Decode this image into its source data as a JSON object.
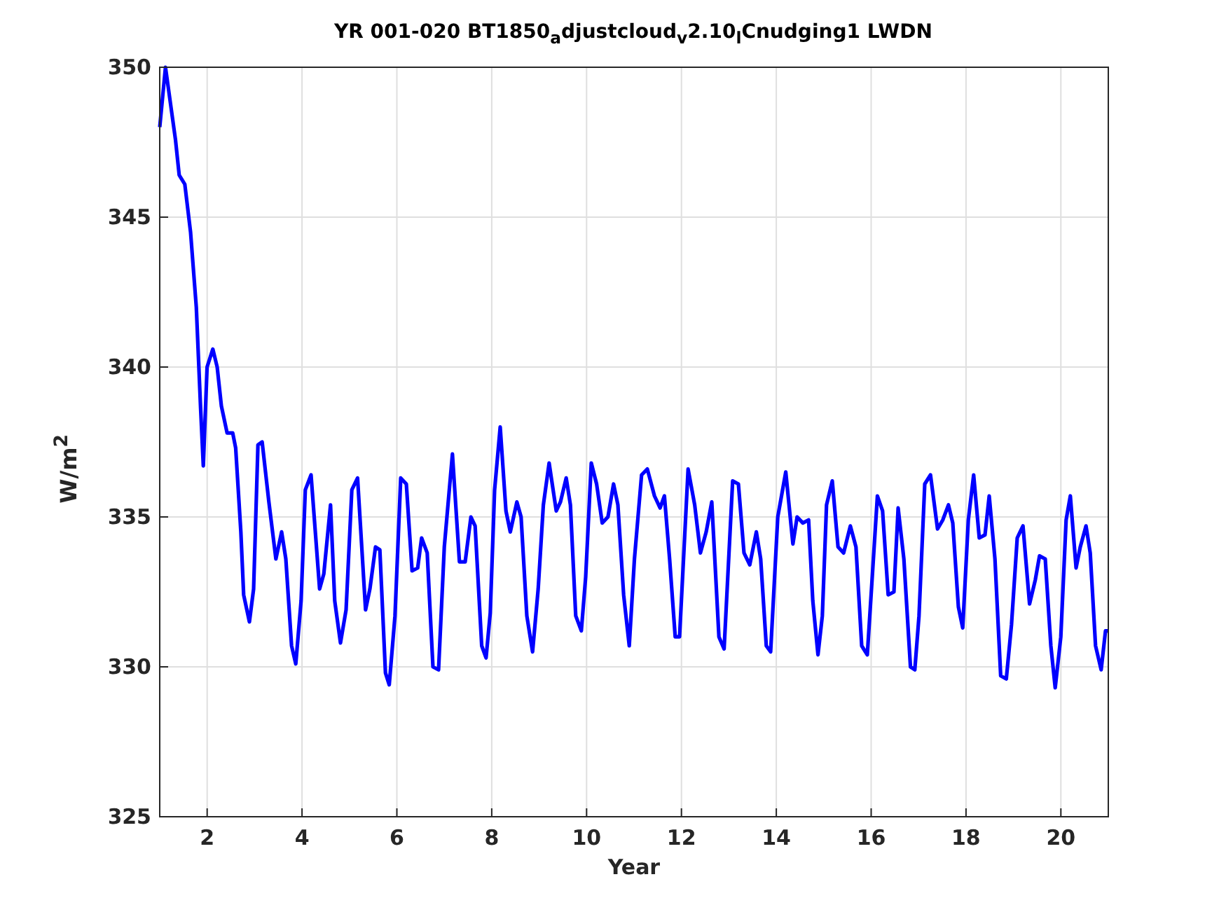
{
  "figure": {
    "chart_data": {
      "type": "line",
      "title": "YR 001-020 BT1850$_{a}$djustcloud$_{v}$2.10$_{l}$Cnudging1 LWDN",
      "xlabel": "Year",
      "ylabel": "W/m$^{2}$",
      "grid": true,
      "xlim": [
        1,
        21
      ],
      "ylim": [
        325,
        350
      ],
      "xticks": [
        2,
        4,
        6,
        8,
        10,
        12,
        14,
        16,
        18,
        20
      ],
      "yticks": [
        325,
        330,
        335,
        340,
        345,
        350
      ],
      "x": [
        1,
        1.12,
        1.33,
        1.41,
        1.53,
        1.65,
        1.77,
        1.86,
        1.92,
        2.0,
        2.12,
        2.21,
        2.3,
        2.42,
        2.54,
        2.6,
        2.71,
        2.77,
        2.89,
        2.98,
        3.07,
        3.16,
        3.3,
        3.45,
        3.57,
        3.66,
        3.78,
        3.87,
        3.98,
        4.07,
        4.19,
        4.37,
        4.46,
        4.6,
        4.69,
        4.81,
        4.93,
        5.05,
        5.17,
        5.34,
        5.43,
        5.55,
        5.64,
        5.76,
        5.84,
        5.96,
        6.08,
        6.2,
        6.32,
        6.44,
        6.52,
        6.64,
        6.76,
        6.88,
        7.0,
        7.17,
        7.32,
        7.44,
        7.56,
        7.65,
        7.79,
        7.88,
        7.97,
        8.06,
        8.18,
        8.3,
        8.39,
        8.53,
        8.62,
        8.74,
        8.86,
        8.98,
        9.09,
        9.21,
        9.36,
        9.45,
        9.57,
        9.66,
        9.77,
        9.89,
        9.98,
        10.1,
        10.21,
        10.33,
        10.45,
        10.57,
        10.66,
        10.78,
        10.9,
        11.01,
        11.16,
        11.28,
        11.43,
        11.55,
        11.64,
        11.75,
        11.87,
        11.96,
        12.14,
        12.28,
        12.4,
        12.52,
        12.64,
        12.79,
        12.9,
        13.08,
        13.2,
        13.32,
        13.44,
        13.58,
        13.67,
        13.79,
        13.88,
        14.03,
        14.2,
        14.35,
        14.44,
        14.56,
        14.68,
        14.77,
        14.88,
        14.97,
        15.06,
        15.18,
        15.3,
        15.42,
        15.56,
        15.68,
        15.8,
        15.92,
        16.13,
        16.24,
        16.36,
        16.48,
        16.57,
        16.69,
        16.83,
        16.92,
        17.01,
        17.13,
        17.25,
        17.4,
        17.51,
        17.63,
        17.72,
        17.84,
        17.93,
        18.05,
        18.16,
        18.28,
        18.4,
        18.49,
        18.61,
        18.73,
        18.85,
        18.96,
        19.08,
        19.2,
        19.34,
        19.46,
        19.55,
        19.67,
        19.79,
        19.88,
        20.0,
        20.11,
        20.2,
        20.32,
        20.41,
        20.53,
        20.62,
        20.73,
        20.85,
        20.94,
        21
      ],
      "series": [
        {
          "color": "#0000ff",
          "values": [
            348,
            350,
            347.6,
            346.4,
            346.1,
            344.5,
            342,
            338.7,
            336.7,
            340,
            340.6,
            340,
            338.7,
            337.8,
            337.8,
            337.3,
            334.5,
            332.4,
            331.5,
            332.6,
            337.4,
            337.5,
            335.5,
            333.6,
            334.5,
            333.6,
            330.7,
            330.1,
            332.2,
            335.9,
            336.4,
            332.6,
            333.1,
            335.4,
            332.2,
            330.8,
            331.9,
            335.9,
            336.3,
            331.9,
            332.6,
            334,
            333.9,
            329.8,
            329.4,
            331.7,
            336.3,
            336.1,
            333.2,
            333.3,
            334.3,
            333.8,
            330,
            329.9,
            334,
            337.1,
            333.5,
            333.5,
            335,
            334.7,
            330.7,
            330.3,
            331.8,
            335.9,
            338,
            335.2,
            334.5,
            335.5,
            335,
            331.7,
            330.5,
            332.6,
            335.4,
            336.8,
            335.2,
            335.5,
            336.3,
            335.4,
            331.7,
            331.2,
            333,
            336.8,
            336.1,
            334.8,
            335,
            336.1,
            335.4,
            332.4,
            330.7,
            333.6,
            336.4,
            336.6,
            335.7,
            335.3,
            335.7,
            333.6,
            331,
            331,
            336.6,
            335.4,
            333.8,
            334.5,
            335.5,
            331,
            330.6,
            336.2,
            336.1,
            333.8,
            333.4,
            334.5,
            333.6,
            330.7,
            330.5,
            335,
            336.5,
            334.1,
            335,
            334.8,
            334.9,
            332.2,
            330.4,
            331.7,
            335.4,
            336.2,
            334,
            333.8,
            334.7,
            334,
            330.7,
            330.4,
            335.7,
            335.2,
            332.4,
            332.5,
            335.3,
            333.6,
            330,
            329.9,
            331.7,
            336.1,
            336.4,
            334.6,
            334.9,
            335.4,
            334.8,
            332,
            331.3,
            334.9,
            336.4,
            334.3,
            334.4,
            335.7,
            333.6,
            329.7,
            329.6,
            331.4,
            334.3,
            334.7,
            332.1,
            332.9,
            333.7,
            333.6,
            330.7,
            329.3,
            331,
            334.9,
            335.7,
            333.3,
            334,
            334.7,
            333.8,
            330.7,
            329.9,
            331.2,
            331.2
          ]
        }
      ]
    }
  }
}
